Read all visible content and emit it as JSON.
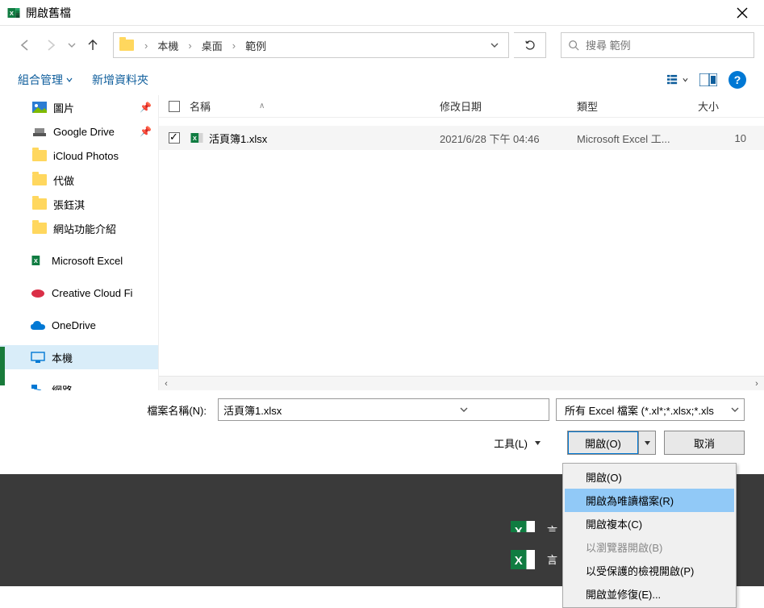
{
  "title": "開啟舊檔",
  "breadcrumb": {
    "items": [
      "本機",
      "桌面",
      "範例"
    ]
  },
  "search": {
    "placeholder": "搜尋 範例"
  },
  "toolbar": {
    "organize": "組合管理",
    "new_folder": "新增資料夾"
  },
  "sidebar": {
    "items": [
      {
        "label": "圖片",
        "icon": "pictures",
        "pinned": true
      },
      {
        "label": "Google Drive",
        "icon": "gdrive",
        "pinned": true
      },
      {
        "label": "iCloud Photos",
        "icon": "folder"
      },
      {
        "label": "代做",
        "icon": "folder"
      },
      {
        "label": "張鈺淇",
        "icon": "folder"
      },
      {
        "label": "網站功能介紹",
        "icon": "folder"
      },
      {
        "label": "Microsoft Excel",
        "icon": "excel"
      },
      {
        "label": "Creative Cloud Fi",
        "icon": "cc"
      },
      {
        "label": "OneDrive",
        "icon": "onedrive"
      },
      {
        "label": "本機",
        "icon": "pc"
      },
      {
        "label": "網路",
        "icon": "network"
      }
    ]
  },
  "columns": {
    "name": "名稱",
    "date": "修改日期",
    "type": "類型",
    "size": "大小"
  },
  "files": [
    {
      "name": "活頁簿1.xlsx",
      "date": "2021/6/28 下午 04:46",
      "type": "Microsoft Excel 工...",
      "size": "10"
    }
  ],
  "bottom": {
    "filename_label": "檔案名稱(N):",
    "filename_value": "活頁簿1.xlsx",
    "filter": "所有 Excel 檔案 (*.xl*;*.xlsx;*.xls",
    "tools": "工具(L)",
    "open": "開啟(O)",
    "cancel": "取消"
  },
  "dropdown": {
    "items": [
      {
        "label": "開啟(O)"
      },
      {
        "label": "開啟為唯讀檔案(R)",
        "selected": true
      },
      {
        "label": "開啟複本(C)"
      },
      {
        "label": "以瀏覽器開啟(B)",
        "disabled": true
      },
      {
        "label": "以受保護的檢視開啟(P)"
      },
      {
        "label": "開啟並修復(E)..."
      }
    ]
  },
  "bg": {
    "t1": "言",
    "t2": "言"
  }
}
